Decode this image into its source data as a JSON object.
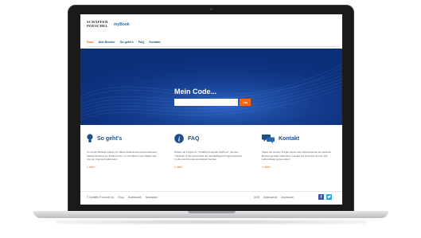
{
  "logo": {
    "line1": "SCHÄFFER",
    "line2": "POESCHEL",
    "product": "myBook"
  },
  "nav": {
    "items": [
      "Start",
      "Alle Bücher",
      "So geht's",
      "FAQ",
      "Kontakt"
    ],
    "active": "Start"
  },
  "hero": {
    "title": "Mein Code...",
    "input_value": "",
    "button_label": "Los"
  },
  "columns": [
    {
      "title": "So geht's",
      "icon": "lightbulb-icon",
      "text": "Zu vielen Büchern bieten wir Ihnen zusätzliches und kostenloses Online-Material an. Erfahren Sie, wo Sie Ihren Code finden und wie der Zugang funktioniert.",
      "more": "» mehr"
    },
    {
      "title": "FAQ",
      "icon": "info-icon",
      "text": "Haben Sie Fragen zu \"Schäffer-Poeschel myBook\" (ebenso \"Website\")? Die Antworten auf die häufigsten Fragen rund um Codes und Download erhalten Sie hier.",
      "more": "» mehr"
    },
    {
      "title": "Kontakt",
      "icon": "chat-bubbles-icon",
      "text": "Wenn Sie weitere Fragen haben oder Informationen zu unserem Buchprogramm wünschen, wenden Sie sich bitte an uns. Wir helfen Ihnen gerne weiter!",
      "more": "» mehr"
    }
  ],
  "footer": {
    "left": [
      "© Schäffer-Poeschel AG",
      "Shop",
      "Buchhandel",
      "Newsletter"
    ],
    "right": [
      "AGB",
      "Datenschutz",
      "Impressum"
    ]
  },
  "colors": {
    "accent": "#f06a1a",
    "brand_blue": "#1f4f8a",
    "hero_bg": "#0c2f7a"
  }
}
